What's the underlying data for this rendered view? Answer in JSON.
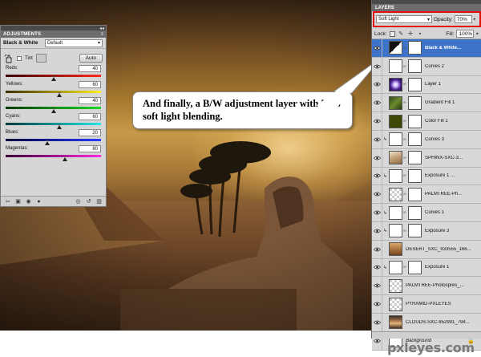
{
  "adjustments": {
    "panel_tab": "ADJUSTMENTS",
    "title": "Black & White",
    "preset": "Default",
    "tint_label": "Tint",
    "auto_label": "Auto",
    "sliders": [
      {
        "label": "Reds:",
        "value": "40",
        "fraction": 0.5,
        "track": [
          "#3a0000",
          "#ff2a1a"
        ]
      },
      {
        "label": "Yellows:",
        "value": "60",
        "fraction": 0.56,
        "track": [
          "#3a3000",
          "#ffee20"
        ]
      },
      {
        "label": "Greens:",
        "value": "40",
        "fraction": 0.5,
        "track": [
          "#003a00",
          "#22d62a"
        ]
      },
      {
        "label": "Cyans:",
        "value": "60",
        "fraction": 0.56,
        "track": [
          "#003a3a",
          "#28e6e6"
        ]
      },
      {
        "label": "Blues:",
        "value": "20",
        "fraction": 0.44,
        "track": [
          "#00003a",
          "#2a3cff"
        ]
      },
      {
        "label": "Magentas:",
        "value": "80",
        "fraction": 0.62,
        "track": [
          "#3a003a",
          "#ff2ae0"
        ]
      }
    ]
  },
  "callout": {
    "text": "And finally, a B/W adjustment layer with 70% soft light blending."
  },
  "layers_panel": {
    "panel_tab": "LAYERS",
    "blend_mode": "Soft Light",
    "opacity_label": "Opacity:",
    "opacity_value": "70%",
    "lock_label": "Lock:",
    "fill_label": "Fill:",
    "fill_value": "100%",
    "layers": [
      {
        "name": "Black & White...",
        "thumb": "t-adj-bw",
        "mask": true,
        "selected": true,
        "clipped": false,
        "italic": false,
        "locked": false
      },
      {
        "name": "Curves 2",
        "thumb": "t-curves",
        "mask": true,
        "selected": false,
        "clipped": false,
        "italic": false,
        "locked": false
      },
      {
        "name": "Layer 1",
        "thumb": "t-radial",
        "mask": true,
        "selected": false,
        "clipped": false,
        "italic": false,
        "locked": false
      },
      {
        "name": "Gradient Fill 1",
        "thumb": "t-gradfill",
        "mask": true,
        "selected": false,
        "clipped": false,
        "italic": false,
        "locked": false
      },
      {
        "name": "Color Fill 1",
        "thumb": "t-colorfill",
        "mask": true,
        "selected": false,
        "clipped": false,
        "italic": false,
        "locked": false
      },
      {
        "name": "Curves 3",
        "thumb": "t-curves",
        "mask": true,
        "selected": false,
        "clipped": true,
        "italic": false,
        "locked": false
      },
      {
        "name": "SPHINX-SXC-3...",
        "thumb": "t-sphinx",
        "mask": true,
        "selected": false,
        "clipped": false,
        "italic": false,
        "locked": false
      },
      {
        "name": "Exposure 1 ...",
        "thumb": "t-curves",
        "mask": true,
        "selected": false,
        "clipped": true,
        "italic": false,
        "locked": false
      },
      {
        "name": "PALMTREE-Ph...",
        "thumb": "t-palm",
        "mask": true,
        "selected": false,
        "clipped": false,
        "italic": false,
        "locked": false
      },
      {
        "name": "Curves 1",
        "thumb": "t-curves",
        "mask": true,
        "selected": false,
        "clipped": true,
        "italic": false,
        "locked": false
      },
      {
        "name": "Exposure 3",
        "thumb": "t-curves",
        "mask": true,
        "selected": false,
        "clipped": true,
        "italic": false,
        "locked": false
      },
      {
        "name": "DESERT_SXC_933555_166...",
        "thumb": "t-desert",
        "mask": false,
        "selected": false,
        "clipped": false,
        "italic": false,
        "locked": false
      },
      {
        "name": "Exposure 1",
        "thumb": "t-curves",
        "mask": true,
        "selected": false,
        "clipped": true,
        "italic": false,
        "locked": false
      },
      {
        "name": "PALMTREE-Photospres_...",
        "thumb": "t-palm",
        "mask": false,
        "selected": false,
        "clipped": false,
        "italic": false,
        "locked": false
      },
      {
        "name": "PYRAMID-PXLEYES",
        "thumb": "t-pyramid",
        "mask": false,
        "selected": false,
        "clipped": false,
        "italic": false,
        "locked": false
      },
      {
        "name": "CLOUDS-SXC-852991_794...",
        "thumb": "t-clouds",
        "mask": false,
        "selected": false,
        "clipped": false,
        "italic": false,
        "locked": false
      },
      {
        "name": "Background",
        "thumb": "t-bg",
        "mask": false,
        "selected": false,
        "clipped": false,
        "italic": true,
        "locked": true
      }
    ]
  },
  "watermark": "pxleyes.com"
}
